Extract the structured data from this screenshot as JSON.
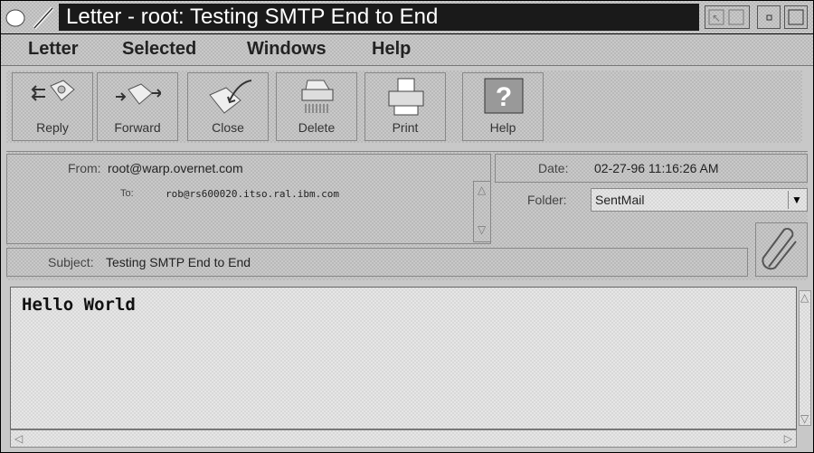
{
  "window": {
    "title": "Letter - root: Testing SMTP End to End"
  },
  "menubar": {
    "items": [
      {
        "label": "Letter"
      },
      {
        "label": "Selected"
      },
      {
        "label": "Windows"
      },
      {
        "label": "Help"
      }
    ]
  },
  "toolbar": {
    "buttons": [
      {
        "label": "Reply",
        "icon": "reply-icon"
      },
      {
        "label": "Forward",
        "icon": "forward-icon"
      },
      {
        "label": "Close",
        "icon": "close-envelope-icon"
      },
      {
        "label": "Delete",
        "icon": "shredder-icon"
      },
      {
        "label": "Print",
        "icon": "printer-icon"
      },
      {
        "label": "Help",
        "icon": "help-icon"
      }
    ]
  },
  "header": {
    "from_label": "From:",
    "from_value": "root@warp.overnet.com",
    "to_label": "To:",
    "to_value": "rob@rs600020.itso.ral.ibm.com",
    "date_label": "Date:",
    "date_value": "02-27-96 11:16:26 AM",
    "folder_label": "Folder:",
    "folder_value": "SentMail",
    "subject_label": "Subject:",
    "subject_value": "Testing SMTP End to End"
  },
  "body": {
    "text": "Hello World"
  }
}
